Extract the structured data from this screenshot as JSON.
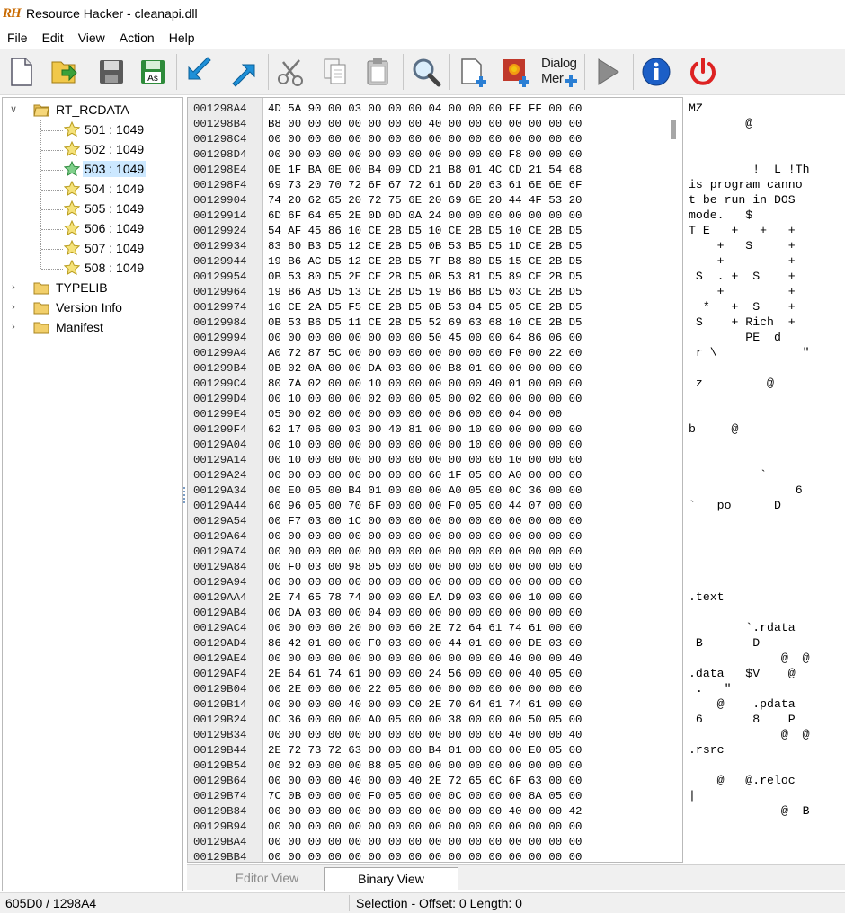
{
  "window": {
    "title": "Resource Hacker - cleanapi.dll",
    "logo_text": "RH"
  },
  "menu": [
    {
      "label": "File"
    },
    {
      "label": "Edit"
    },
    {
      "label": "View"
    },
    {
      "label": "Action"
    },
    {
      "label": "Help"
    }
  ],
  "toolbar": {
    "dialog_menu_label_1": "Dialog",
    "dialog_menu_label_2": "Mer"
  },
  "tree": {
    "root": "RT_RCDATA",
    "children": [
      "501 : 1049",
      "502 : 1049",
      "503 : 1049",
      "504 : 1049",
      "505 : 1049",
      "506 : 1049",
      "507 : 1049",
      "508 : 1049"
    ],
    "selected": "503 : 1049",
    "others": [
      "TYPELIB",
      "Version Info",
      "Manifest"
    ]
  },
  "hex": {
    "addresses": [
      "001298A4",
      "001298B4",
      "001298C4",
      "001298D4",
      "001298E4",
      "001298F4",
      "00129904",
      "00129914",
      "00129924",
      "00129934",
      "00129944",
      "00129954",
      "00129964",
      "00129974",
      "00129984",
      "00129994",
      "001299A4",
      "001299B4",
      "001299C4",
      "001299D4",
      "001299E4",
      "001299F4",
      "00129A04",
      "00129A14",
      "00129A24",
      "00129A34",
      "00129A44",
      "00129A54",
      "00129A64",
      "00129A74",
      "00129A84",
      "00129A94",
      "00129AA4",
      "00129AB4",
      "00129AC4",
      "00129AD4",
      "00129AE4",
      "00129AF4",
      "00129B04",
      "00129B14",
      "00129B24",
      "00129B34",
      "00129B44",
      "00129B54",
      "00129B64",
      "00129B74",
      "00129B84",
      "00129B94",
      "00129BA4",
      "00129BB4"
    ],
    "bytes": [
      "4D 5A 90 00 03 00 00 00 04 00 00 00 FF FF 00 00",
      "B8 00 00 00 00 00 00 00 40 00 00 00 00 00 00 00",
      "00 00 00 00 00 00 00 00 00 00 00 00 00 00 00 00",
      "00 00 00 00 00 00 00 00 00 00 00 00 F8 00 00 00",
      "0E 1F BA 0E 00 B4 09 CD 21 B8 01 4C CD 21 54 68",
      "69 73 20 70 72 6F 67 72 61 6D 20 63 61 6E 6E 6F",
      "74 20 62 65 20 72 75 6E 20 69 6E 20 44 4F 53 20",
      "6D 6F 64 65 2E 0D 0D 0A 24 00 00 00 00 00 00 00",
      "54 AF 45 86 10 CE 2B D5 10 CE 2B D5 10 CE 2B D5",
      "83 80 B3 D5 12 CE 2B D5 0B 53 B5 D5 1D CE 2B D5",
      "19 B6 AC D5 12 CE 2B D5 7F B8 80 D5 15 CE 2B D5",
      "0B 53 80 D5 2E CE 2B D5 0B 53 81 D5 89 CE 2B D5",
      "19 B6 A8 D5 13 CE 2B D5 19 B6 B8 D5 03 CE 2B D5",
      "10 CE 2A D5 F5 CE 2B D5 0B 53 84 D5 05 CE 2B D5",
      "0B 53 B6 D5 11 CE 2B D5 52 69 63 68 10 CE 2B D5",
      "00 00 00 00 00 00 00 00 50 45 00 00 64 86 06 00",
      "A0 72 87 5C 00 00 00 00 00 00 00 00 F0 00 22 00",
      "0B 02 0A 00 00 DA 03 00 00 B8 01 00 00 00 00 00",
      "80 7A 02 00 00 10 00 00 00 00 00 40 01 00 00 00",
      "00 10 00 00 00 02 00 00 05 00 02 00 00 00 00 00",
      "05 00 02 00 00 00 00 00 00 06 00 00 04 00 00",
      "62 17 06 00 03 00 40 81 00 00 10 00 00 00 00 00",
      "00 10 00 00 00 00 00 00 00 00 10 00 00 00 00 00",
      "00 10 00 00 00 00 00 00 00 00 00 00 10 00 00 00",
      "00 00 00 00 00 00 00 00 60 1F 05 00 A0 00 00 00",
      "00 E0 05 00 B4 01 00 00 00 A0 05 00 0C 36 00 00",
      "60 96 05 00 70 6F 00 00 00 F0 05 00 44 07 00 00",
      "00 F7 03 00 1C 00 00 00 00 00 00 00 00 00 00 00",
      "00 00 00 00 00 00 00 00 00 00 00 00 00 00 00 00",
      "00 00 00 00 00 00 00 00 00 00 00 00 00 00 00 00",
      "00 F0 03 00 98 05 00 00 00 00 00 00 00 00 00 00",
      "00 00 00 00 00 00 00 00 00 00 00 00 00 00 00 00",
      "2E 74 65 78 74 00 00 00 EA D9 03 00 00 10 00 00",
      "00 DA 03 00 00 04 00 00 00 00 00 00 00 00 00 00",
      "00 00 00 00 20 00 00 60 2E 72 64 61 74 61 00 00",
      "86 42 01 00 00 F0 03 00 00 44 01 00 00 DE 03 00",
      "00 00 00 00 00 00 00 00 00 00 00 00 40 00 00 40",
      "2E 64 61 74 61 00 00 00 24 56 00 00 00 40 05 00",
      "00 2E 00 00 00 22 05 00 00 00 00 00 00 00 00 00",
      "00 00 00 00 40 00 00 C0 2E 70 64 61 74 61 00 00",
      "0C 36 00 00 00 A0 05 00 00 38 00 00 00 50 05 00",
      "00 00 00 00 00 00 00 00 00 00 00 00 40 00 00 40",
      "2E 72 73 72 63 00 00 00 B4 01 00 00 00 E0 05 00",
      "00 02 00 00 00 88 05 00 00 00 00 00 00 00 00 00",
      "00 00 00 00 40 00 00 40 2E 72 65 6C 6F 63 00 00",
      "7C 0B 00 00 00 F0 05 00 00 0C 00 00 00 8A 05 00",
      "00 00 00 00 00 00 00 00 00 00 00 00 40 00 00 42",
      "00 00 00 00 00 00 00 00 00 00 00 00 00 00 00 00",
      "00 00 00 00 00 00 00 00 00 00 00 00 00 00 00 00",
      "00 00 00 00 00 00 00 00 00 00 00 00 00 00 00 00"
    ],
    "ascii": [
      "MZ",
      "        @",
      "",
      "",
      "         !  L !Th",
      "is program canno",
      "t be run in DOS",
      "mode.   $",
      "T E   +   +   +",
      "    +   S     +",
      "    +         +",
      " S  . +  S    +",
      "    +         +",
      "  *   +  S    +",
      " S    + Rich  +",
      "        PE  d",
      " r \\            \"",
      "",
      " z         @",
      "",
      "",
      "b     @",
      "",
      "",
      "          `",
      "               6",
      "`   po      D",
      "",
      "",
      "",
      "",
      "",
      ".text",
      "",
      "        `.rdata",
      " B       D",
      "             @  @",
      ".data   $V    @",
      " .   \"",
      "    @    .pdata",
      " 6       8    P",
      "             @  @",
      ".rsrc",
      "",
      "    @   @.reloc",
      "|",
      "             @  B",
      "",
      "",
      ""
    ]
  },
  "tabs": {
    "editor": "Editor View",
    "binary": "Binary View"
  },
  "status": {
    "left": "605D0 / 1298A4",
    "right": "Selection - Offset: 0 Length: 0"
  }
}
